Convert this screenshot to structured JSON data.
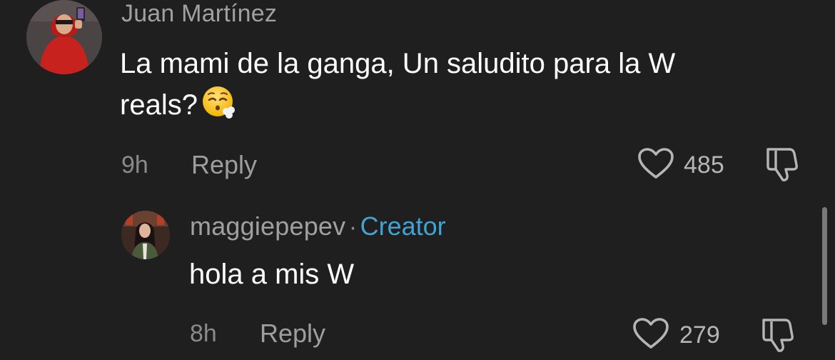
{
  "comments": [
    {
      "username": "Juan Martínez",
      "text": "La mami de la ganga, Un saludito para la W reals?",
      "text_line1": "La mami de la ganga, Un saludito para la W",
      "text_line2": "reals?",
      "emoji": "face-exhaling-emoji",
      "time": "9h",
      "reply_label": "Reply",
      "likes": "485",
      "avatar": "user-avatar-red-hoodie"
    },
    {
      "username": "maggiepepev",
      "separator": "·",
      "badge": "Creator",
      "text": "hola a mis W",
      "time": "8h",
      "reply_label": "Reply",
      "likes": "279",
      "avatar": "creator-avatar"
    }
  ],
  "icons": {
    "like": "heart-outline-icon",
    "dislike": "thumbs-down-outline-icon"
  },
  "colors": {
    "background": "#1f1f1f",
    "creator_badge": "#3fa3d6",
    "username": "#a0a0a0"
  }
}
